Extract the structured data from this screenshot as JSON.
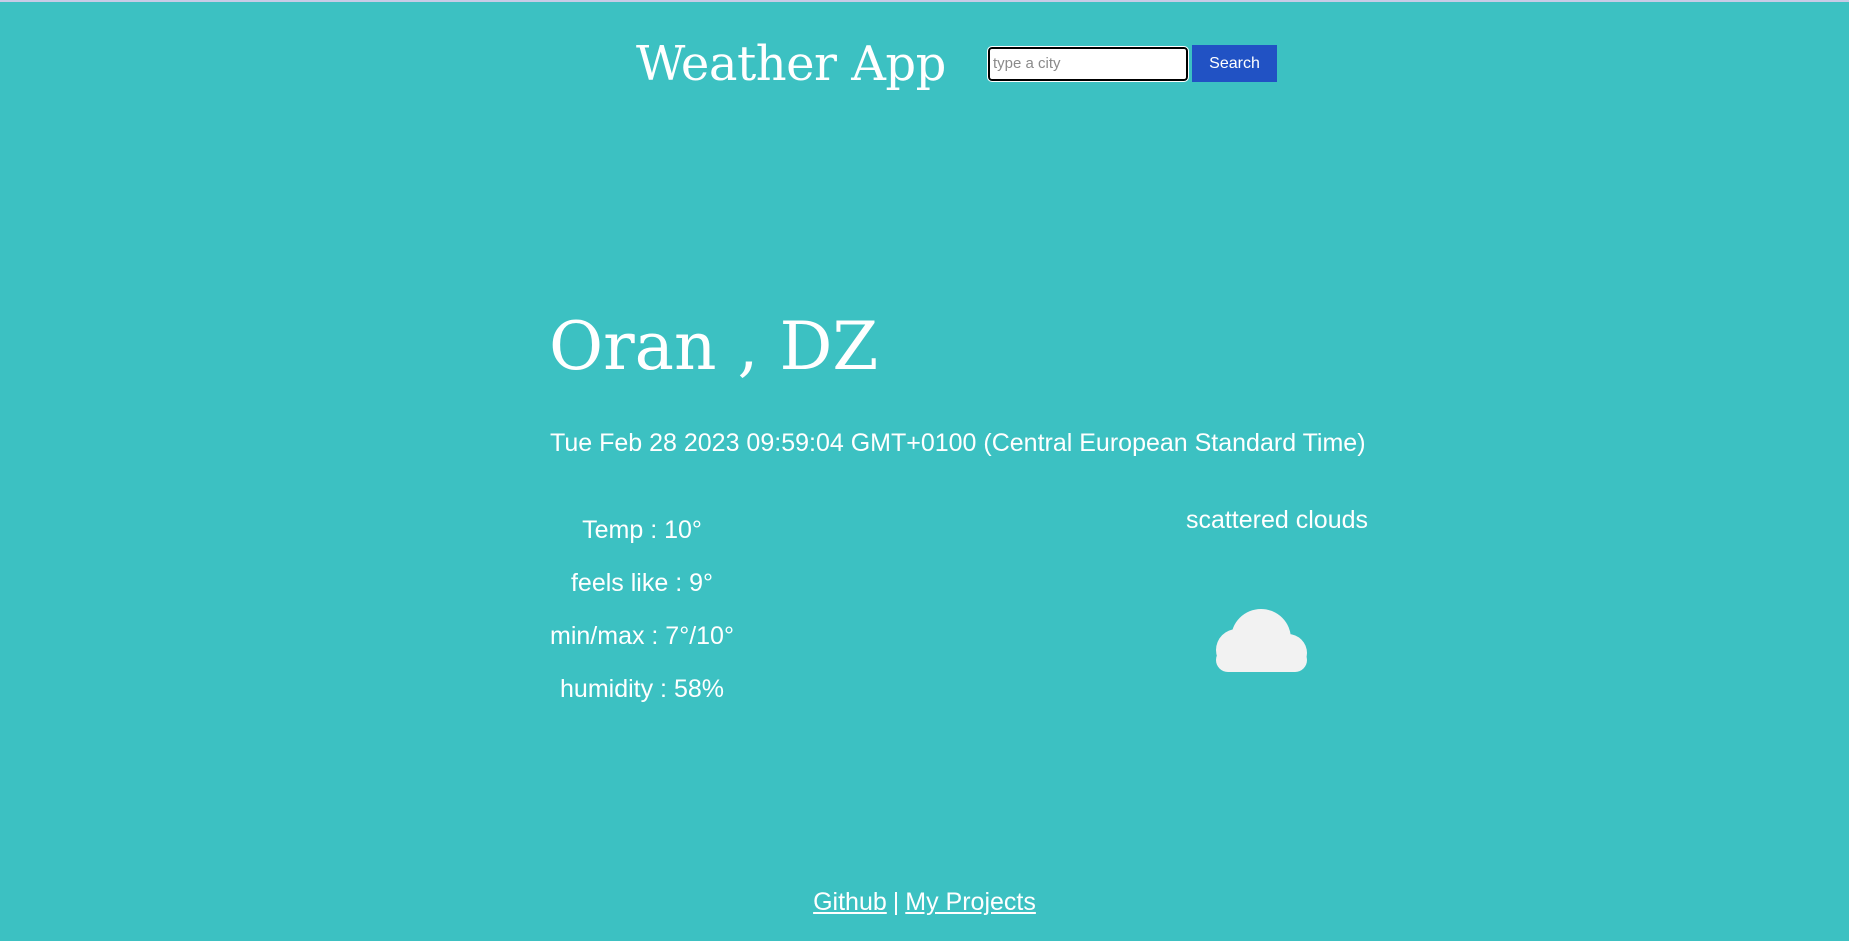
{
  "header": {
    "title": "Weather App",
    "search_placeholder": "type a city",
    "search_value": "",
    "search_button_label": "Search"
  },
  "weather": {
    "city": "Oran , DZ",
    "datetime": "Tue Feb 28 2023 09:59:04 GMT+0100 (Central European Standard Time)",
    "temp": "Temp : 10°",
    "feels_like": "feels like : 9°",
    "min_max": "min/max : 7°/10°",
    "humidity": "humidity : 58%",
    "description": "scattered clouds",
    "icon": "cloud-icon"
  },
  "footer": {
    "github_label": "Github",
    "separator": "|",
    "projects_label": "My Projects"
  },
  "colors": {
    "background": "#3cc1c2",
    "button": "#2152c4",
    "text": "#ffffff",
    "cloud": "#f2f2f2"
  }
}
